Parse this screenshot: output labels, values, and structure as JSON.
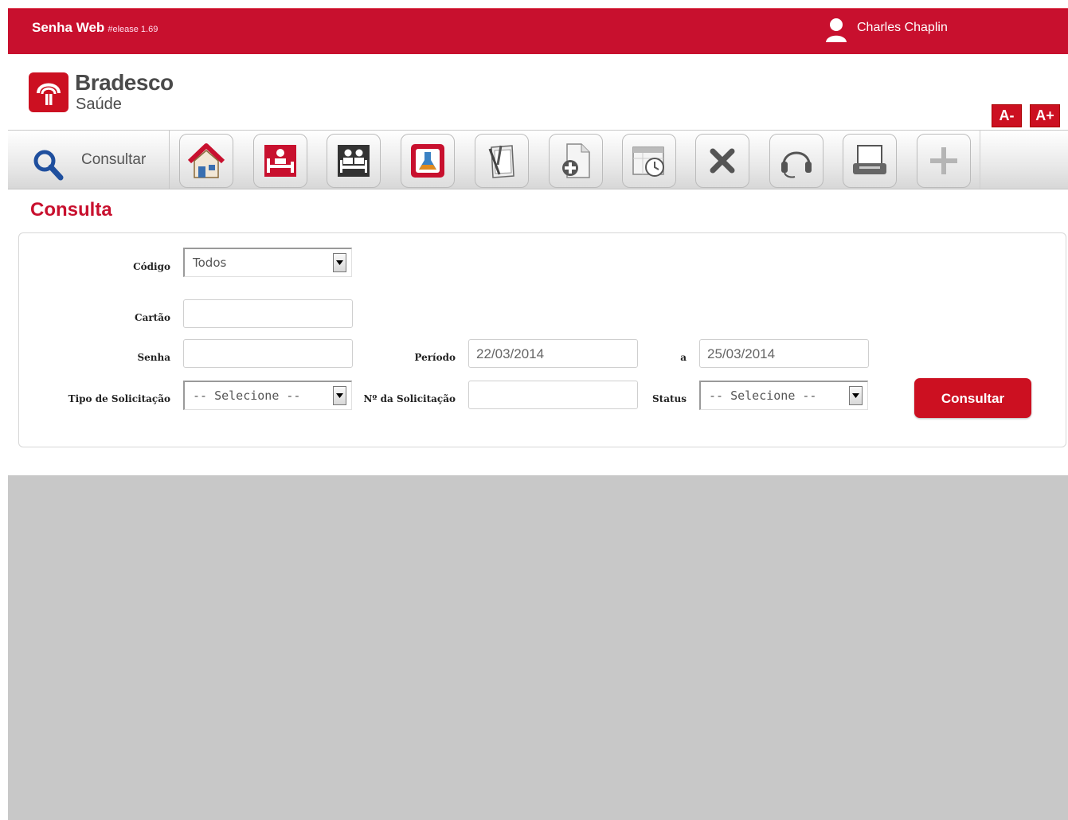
{
  "header": {
    "app_name": "Senha Web",
    "release": "#elease 1.69",
    "user_name": "Charles Chaplin"
  },
  "brand": {
    "name": "Bradesco",
    "sub": "Saúde"
  },
  "font_controls": {
    "decrease": "A-",
    "increase": "A+"
  },
  "toolbar": {
    "consult_label": "Consultar",
    "buttons": [
      "home-icon",
      "hospital-bed-icon",
      "hospital-room-icon",
      "lab-flask-icon",
      "prescription-icon",
      "add-document-icon",
      "calendar-clock-icon",
      "close-icon",
      "headset-icon",
      "printer-icon",
      "plus-icon"
    ]
  },
  "page": {
    "title": "Consulta"
  },
  "form": {
    "codigo": {
      "label": "Código",
      "value": "Todos"
    },
    "cartao": {
      "label": "Cartão",
      "value": ""
    },
    "senha": {
      "label": "Senha",
      "value": ""
    },
    "periodo": {
      "label": "Período",
      "from": "22/03/2014",
      "to_label": "a",
      "to": "25/03/2014"
    },
    "tipo": {
      "label": "Tipo de Solicitação",
      "value": "-- Selecione --"
    },
    "numero": {
      "label": "Nº da Solicitação",
      "value": ""
    },
    "status": {
      "label": "Status",
      "value": "-- Selecione --"
    },
    "submit": "Consultar"
  },
  "colors": {
    "brand_red": "#c8102e",
    "bottom_gray": "#c8c8c8"
  }
}
